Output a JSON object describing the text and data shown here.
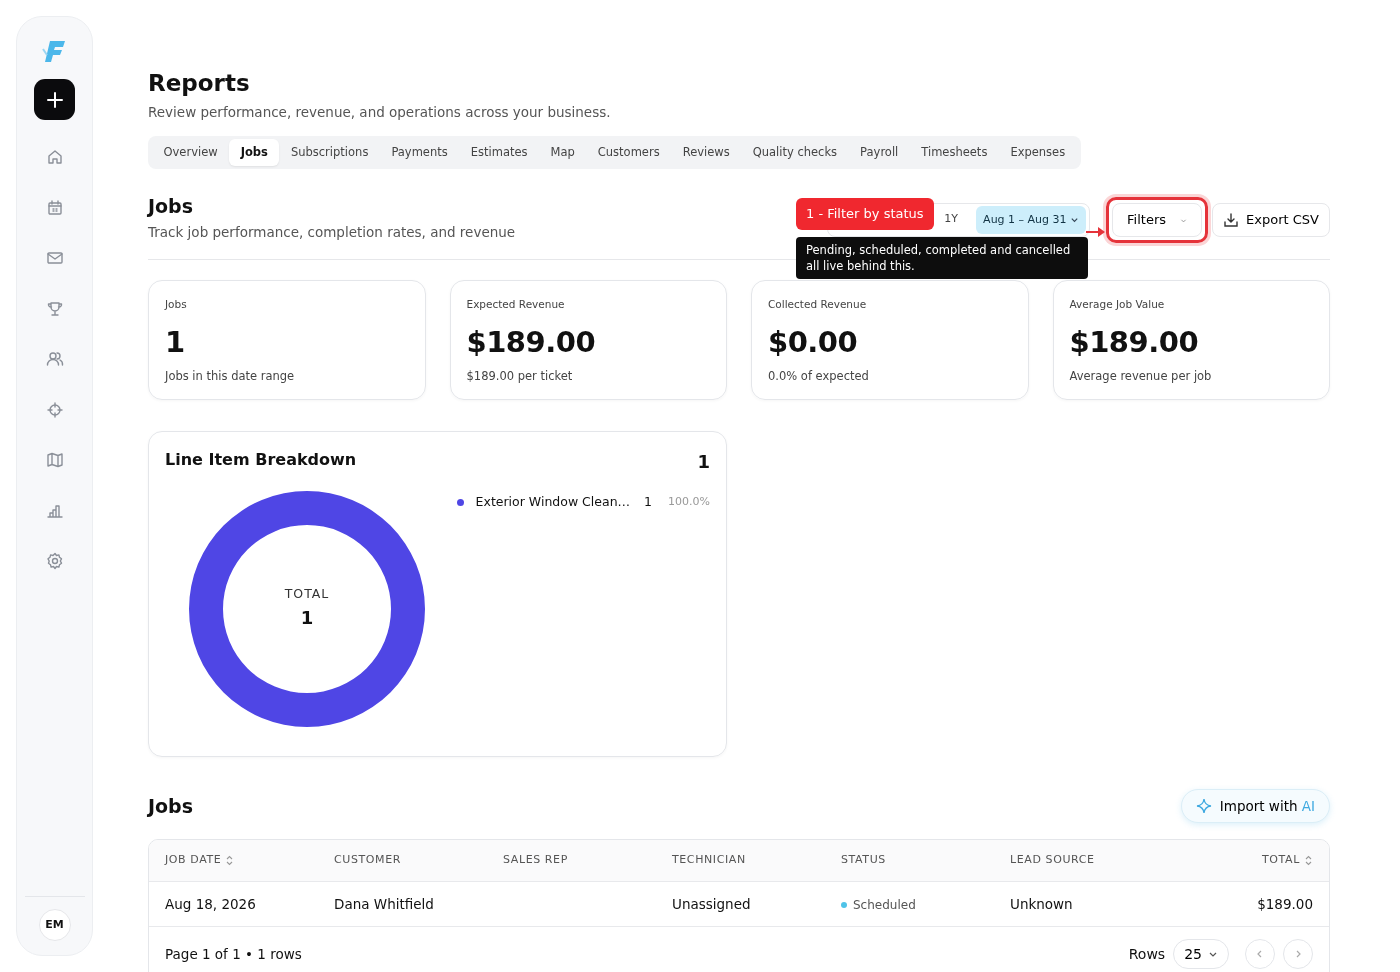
{
  "sidebar": {
    "avatar": "EM"
  },
  "page": {
    "title": "Reports",
    "subtitle": "Review performance, revenue, and operations across your business."
  },
  "tabs": [
    {
      "label": "Overview",
      "selected": false
    },
    {
      "label": "Jobs",
      "selected": true
    },
    {
      "label": "Subscriptions",
      "selected": false
    },
    {
      "label": "Payments",
      "selected": false
    },
    {
      "label": "Estimates",
      "selected": false
    },
    {
      "label": "Map",
      "selected": false
    },
    {
      "label": "Customers",
      "selected": false
    },
    {
      "label": "Reviews",
      "selected": false
    },
    {
      "label": "Quality checks",
      "selected": false
    },
    {
      "label": "Payroll",
      "selected": false
    },
    {
      "label": "Timesheets",
      "selected": false
    },
    {
      "label": "Expenses",
      "selected": false
    }
  ],
  "section": {
    "title": "Jobs",
    "subtitle": "Track job performance, completion rates, and revenue"
  },
  "range_options": [
    {
      "label": "1Y",
      "selected": false
    }
  ],
  "date_range": "Aug 1 – Aug 31",
  "filters_button": "Filters",
  "export_button": "Export CSV",
  "callout": {
    "label": "1 - Filter by status",
    "text": "Pending, scheduled, completed and cancelled all live behind this."
  },
  "stats": [
    {
      "label": "Jobs",
      "value": "1",
      "note": "Jobs in this date range"
    },
    {
      "label": "Expected Revenue",
      "value": "$189.00",
      "note": "$189.00 per ticket"
    },
    {
      "label": "Collected Revenue",
      "value": "$0.00",
      "note": "0.0% of expected"
    },
    {
      "label": "Average Job Value",
      "value": "$189.00",
      "note": "Average revenue per job"
    }
  ],
  "breakdown": {
    "title": "Line Item Breakdown",
    "count": "1",
    "center_label": "TOTAL",
    "center_value": "1",
    "legend": [
      {
        "label": "Exterior Window Clean…",
        "count": "1",
        "percent": "100.0%",
        "color": "#4f46e5"
      }
    ]
  },
  "jobs": {
    "title": "Jobs",
    "import_button": "Import with ",
    "import_highlight": "AI",
    "columns": [
      {
        "label": "JOB DATE",
        "sortable": true
      },
      {
        "label": "CUSTOMER",
        "sortable": false
      },
      {
        "label": "SALES REP",
        "sortable": false
      },
      {
        "label": "TECHNICIAN",
        "sortable": false
      },
      {
        "label": "STATUS",
        "sortable": false
      },
      {
        "label": "LEAD SOURCE",
        "sortable": false
      },
      {
        "label": "TOTAL",
        "sortable": true
      }
    ],
    "rows": [
      {
        "job_date": "Aug 18, 2026",
        "customer": "Dana Whitfield",
        "technician": "Unassigned",
        "status": {
          "label": "Scheduled",
          "color": "#4fc3e8"
        },
        "lead_source": "Unknown",
        "total": "$189.00"
      }
    ],
    "page_info": "Page 1 of 1 • 1 rows",
    "rows_label": "Rows",
    "rows_per_page": "25"
  }
}
